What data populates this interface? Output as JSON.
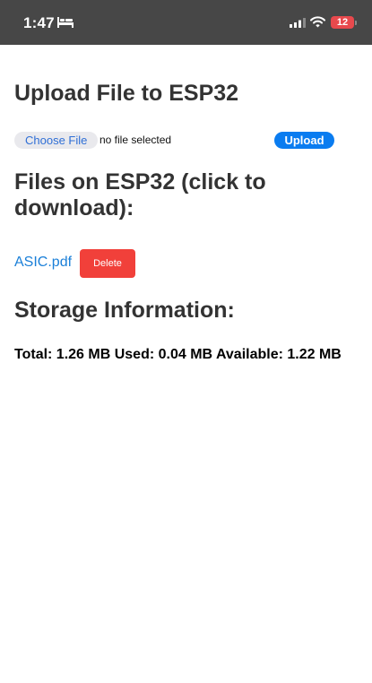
{
  "status_bar": {
    "time": "1:47",
    "battery_level": "12",
    "icons": [
      "bed-icon",
      "signal-icon",
      "wifi-icon",
      "battery-icon"
    ],
    "colors": {
      "background": "#474747",
      "battery": "#e8494d"
    }
  },
  "upload": {
    "title": "Upload File to ESP32",
    "choose_label": "Choose File",
    "no_file_text": "no file selected",
    "upload_label": "Upload"
  },
  "files": {
    "title": "Files on ESP32 (click to download):",
    "items": [
      {
        "name": "ASIC.pdf",
        "delete_label": "Delete"
      }
    ]
  },
  "storage": {
    "title": "Storage Information:",
    "info": "Total: 1.26 MB Used: 0.04 MB Available: 1.22 MB"
  },
  "colors": {
    "link": "#1a7fd8",
    "upload_button": "#0a7cf0",
    "delete_button": "#f1403a"
  }
}
